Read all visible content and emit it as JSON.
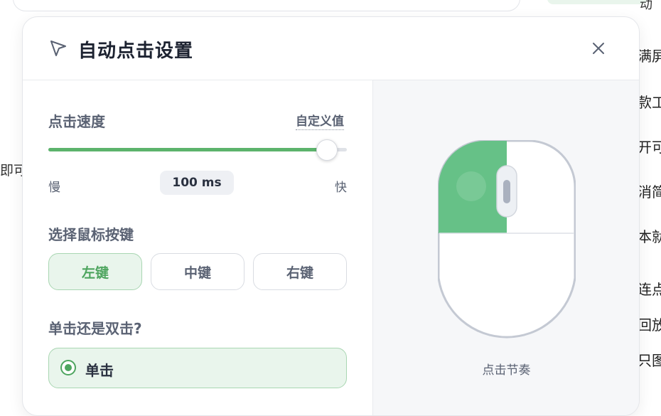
{
  "background": {
    "top_text": "动",
    "left_text": "即可",
    "right_fragments": [
      "满屏",
      "款工",
      "开可",
      "消简",
      "本就",
      "连点",
      "回放",
      "只图"
    ]
  },
  "dialog": {
    "title": "自动点击设置",
    "icons": {
      "title_icon": "cursor-arrow-icon",
      "close_icon": "close-icon"
    },
    "speed": {
      "label": "点击速度",
      "custom_link": "自定义值",
      "slow_label": "慢",
      "fast_label": "快",
      "value": "100 ms",
      "slider_fraction": 0.93
    },
    "mouse_button": {
      "label": "选择鼠标按键",
      "options": [
        "左键",
        "中键",
        "右键"
      ],
      "selected": "左键"
    },
    "click_type": {
      "label": "单击还是双击?",
      "selected_option": "单击"
    },
    "preview": {
      "caption": "点击节奏",
      "active_button": "left"
    }
  },
  "colors": {
    "accent": "#5cb36c",
    "accent_light": "#e9f5ec",
    "text_dark": "#1c2230",
    "text_muted": "#5a6273"
  }
}
